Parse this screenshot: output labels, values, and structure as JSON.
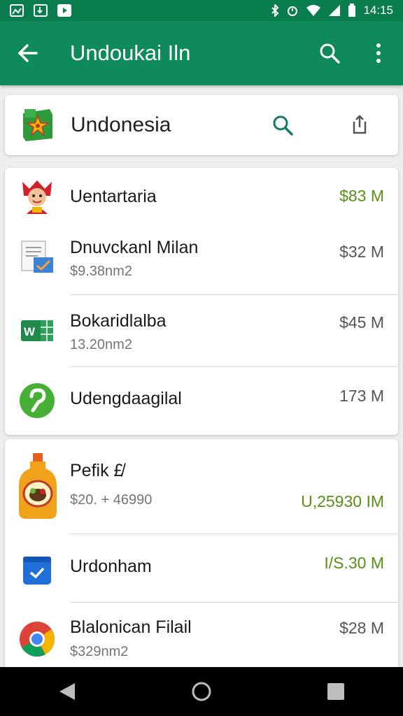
{
  "status_bar": {
    "time": "14:15",
    "left_icons": [
      "gallery-icon",
      "sim-card-icon",
      "play-store-icon"
    ],
    "right_icons": [
      "bluetooth-icon",
      "alarm-icon",
      "wifi-icon",
      "signal-icon",
      "battery-icon"
    ]
  },
  "app_bar": {
    "title": "Undoukai Iln",
    "back_icon": "arrow-left-icon",
    "search_icon": "search-icon",
    "menu_icon": "more-vert-icon"
  },
  "header_card": {
    "title": "Undonesia",
    "logo_icon": "star-shield-icon",
    "search_icon": "search-icon",
    "share_icon": "share-icon"
  },
  "list_1": [
    {
      "name": "Uentartaria",
      "sub": "",
      "amount": "$83 M",
      "icon": "red-mascot-icon",
      "accent": "green"
    },
    {
      "name": "Dnuvckanl Milan",
      "sub": "$9.38nm2",
      "amount": "$32 M",
      "icon": "document-icon",
      "accent": "gray"
    },
    {
      "name": "Bokaridlalba",
      "sub": "13.20nm2",
      "amount": "$45 M",
      "icon": "spreadsheet-icon",
      "accent": "gray"
    },
    {
      "name": "Udengdaagilal",
      "sub": "",
      "amount": "173 M",
      "icon": "green-circle-app-icon",
      "accent": "gray"
    }
  ],
  "list_2": [
    {
      "name": "Pefik £̸",
      "sub": "$20. + 46990",
      "amount": "U,25930 IM",
      "icon": "juice-bottle-icon",
      "accent": "green"
    },
    {
      "name": "Urdonham",
      "sub": "",
      "amount": "I/S.30 M",
      "icon": "blue-check-app-icon",
      "accent": "green"
    },
    {
      "name": "Blalonican Filail",
      "sub": "$329nm2",
      "amount": "$28 M",
      "icon": "chrome-icon",
      "accent": "gray"
    }
  ],
  "colors": {
    "app_bar": "#0f8a5a",
    "status_bar": "#0a7d4e",
    "amount_green": "#5a8f16"
  },
  "nav_bar": {
    "icons": [
      "back-triangle-icon",
      "home-circle-icon",
      "recents-square-icon"
    ]
  }
}
